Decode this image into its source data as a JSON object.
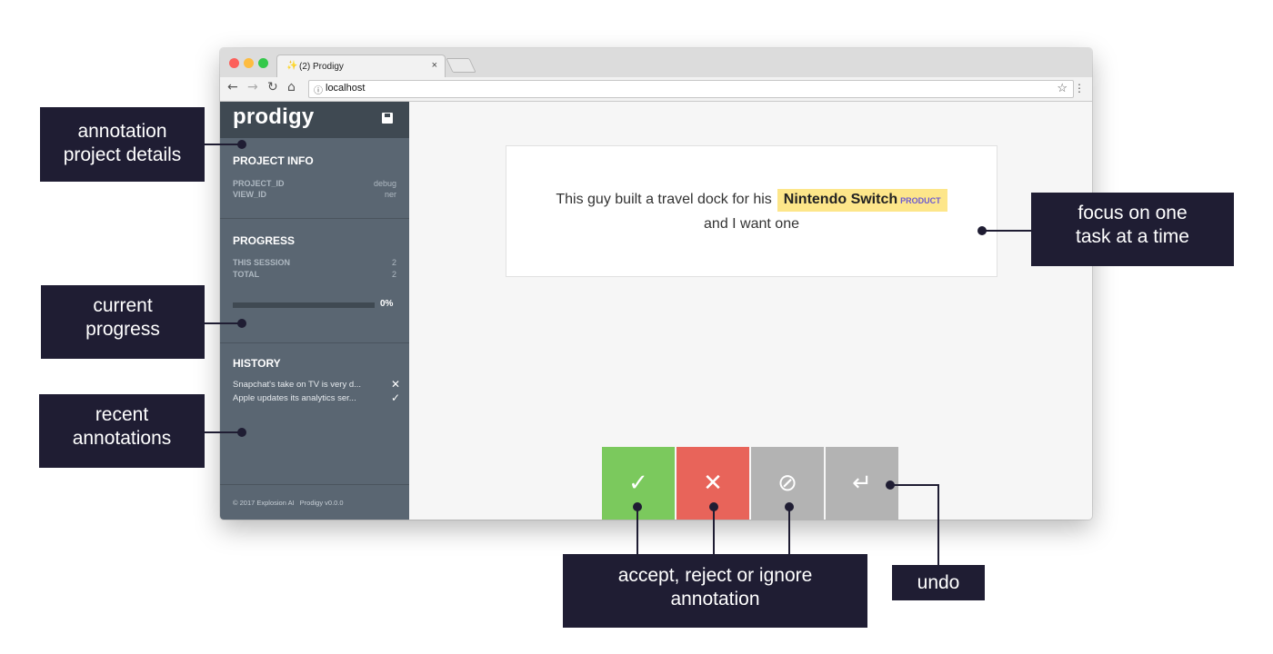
{
  "browser": {
    "tab_title": "(2) Prodigy",
    "tab_favicon": "✨",
    "tab_close": "×",
    "back_icon": "←",
    "forward_icon": "→",
    "reload_icon": "↻",
    "home_icon": "⌂",
    "info_icon": "ⓘ",
    "url": "localhost",
    "star_icon": "☆",
    "menu_icon": "⋮"
  },
  "sidebar": {
    "logo": "prodigy",
    "project_info": {
      "title": "PROJECT INFO",
      "rows": [
        {
          "key": "PROJECT_ID",
          "value": "debug"
        },
        {
          "key": "VIEW_ID",
          "value": "ner"
        }
      ]
    },
    "progress": {
      "title": "PROGRESS",
      "rows": [
        {
          "key": "THIS SESSION",
          "value": "2"
        },
        {
          "key": "TOTAL",
          "value": "2"
        }
      ],
      "percent_label": "0%",
      "fraction": 0.0
    },
    "history": {
      "title": "HISTORY",
      "items": [
        {
          "text": "Snapchat's take on TV is very d...",
          "mark": "✕"
        },
        {
          "text": "Apple updates its analytics ser...",
          "mark": "✓"
        }
      ]
    },
    "footer": {
      "copyright": "© 2017 Explosion AI",
      "version": "Prodigy v0.0.0"
    }
  },
  "task": {
    "text_before": "This guy built a travel dock for his",
    "entity_text": "Nintendo Switch",
    "entity_label": "PRODUCT",
    "text_after": "and I want one"
  },
  "actions": {
    "accept": "✓",
    "reject": "✕",
    "ignore": "⊘",
    "undo": "↵"
  },
  "callouts": {
    "project_details": [
      "annotation",
      "project details"
    ],
    "current_progress": [
      "current",
      "progress"
    ],
    "recent_annotations": [
      "recent",
      "annotations"
    ],
    "focus": [
      "focus on one",
      "task at a time"
    ],
    "accept_reject": [
      "accept, reject or ignore",
      "annotation"
    ],
    "undo": [
      "undo"
    ]
  },
  "colors": {
    "accept": "#7bc95d",
    "reject": "#e8645a",
    "ignore": "#b3b3b3",
    "sidebar": "#5a6672",
    "callout": "#1f1d33",
    "entity_highlight": "#fde68a"
  }
}
